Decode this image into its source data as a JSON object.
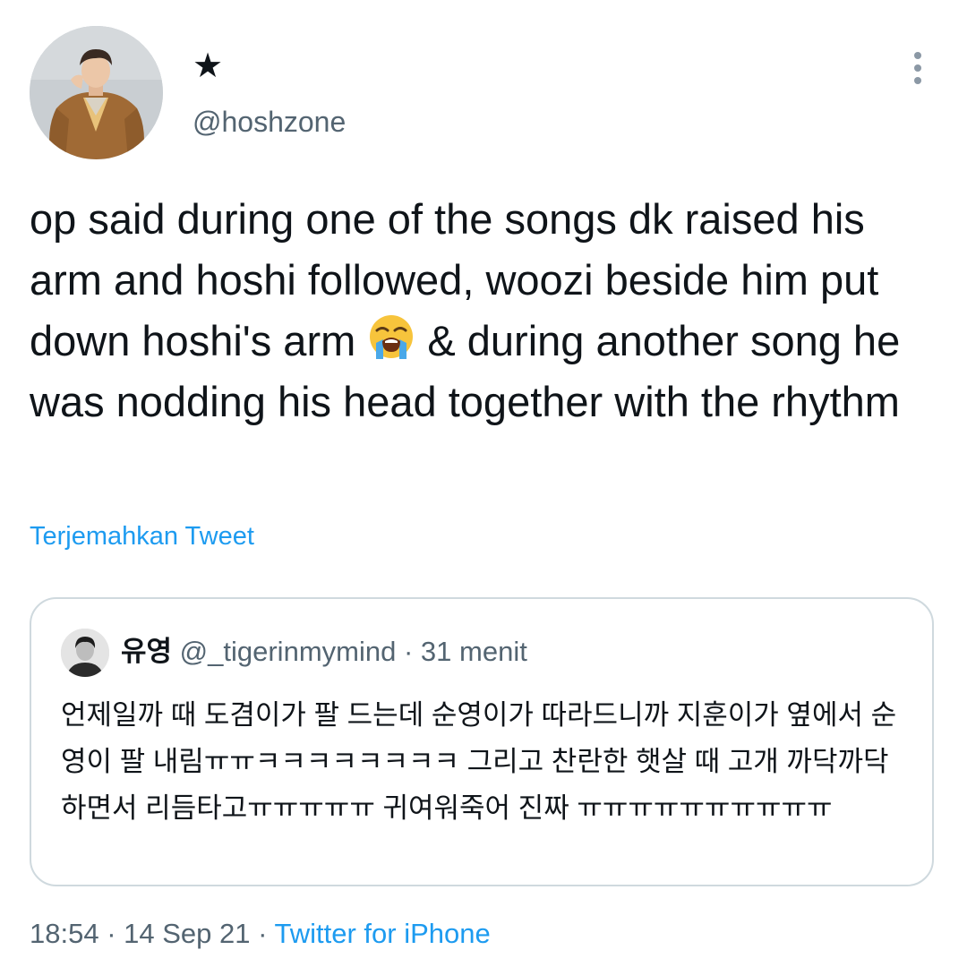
{
  "author": {
    "display_name": "★",
    "handle": "@hoshzone",
    "avatar": "profile-photo-man-in-brown-jacket"
  },
  "more_icon": "more-vertical-icon",
  "tweet": {
    "text_part1": "op said during one of the songs dk raised his arm and hoshi followed, woozi beside him put down hoshi's arm ",
    "emoji": "loudly-crying-face-emoji",
    "text_part2": " & during another song he was nodding his head together with the rhythm",
    "translate_label": "Terjemahkan Tweet"
  },
  "quote": {
    "display_name": "유영",
    "handle": "@_tigerinmymind",
    "separator": "·",
    "time": "31 menit",
    "avatar": "profile-photo-man-black-and-white",
    "text": "언제일까 때 도겸이가 팔 드는데 순영이가 따라드니까 지훈이가 옆에서 순영이 팔 내림ㅠㅠㅋㅋㅋㅋㅋㅋㅋㅋ 그리고 찬란한 햇살 때 고개 까닥까닥하면서 리듬타고ㅠㅠㅠㅠㅠ 귀여워죽어 진짜 ㅠㅠㅠㅠㅠㅠㅠㅠㅠㅠ"
  },
  "meta": {
    "time": "18:54",
    "sep1": " · ",
    "date": "14 Sep 21",
    "sep2": " · ",
    "source": "Twitter for iPhone"
  },
  "colors": {
    "link": "#1d9bf0",
    "muted": "#536471",
    "text": "#0f1419",
    "border": "#cfd9de"
  }
}
